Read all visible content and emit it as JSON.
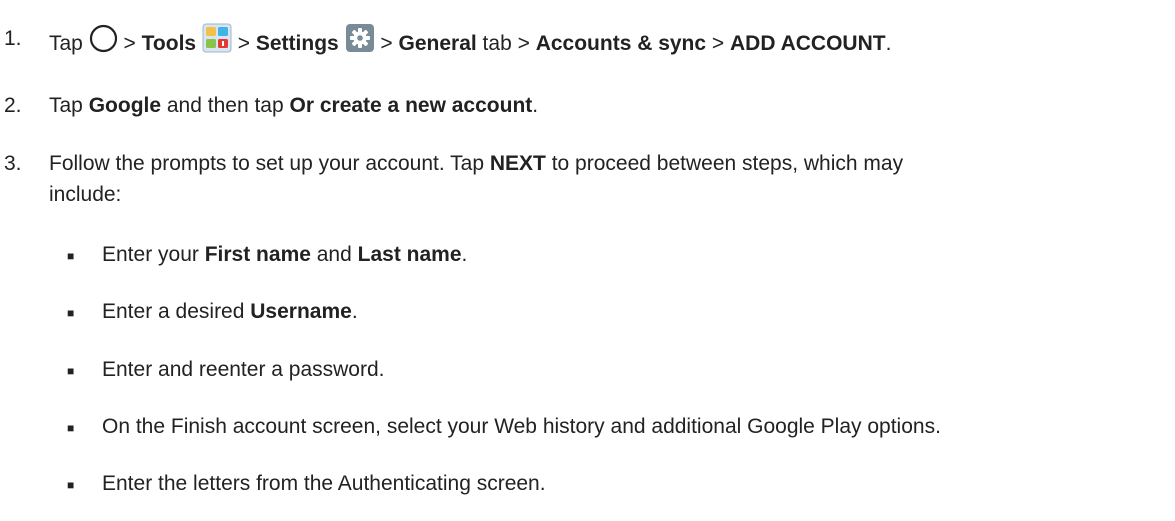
{
  "steps": [
    {
      "num": "1.",
      "s0": "Tap ",
      "s1": " > ",
      "tools": "Tools",
      "s2": " > ",
      "settings": "Settings",
      "s3": " > ",
      "general": "General",
      "s4": " tab > ",
      "accounts": "Accounts & sync",
      "s5": " > ",
      "add": "ADD ACCOUNT",
      "s6": "."
    },
    {
      "num": "2.",
      "s0": "Tap ",
      "google": "Google",
      "s1": " and then tap ",
      "create": "Or create a new account",
      "s2": "."
    },
    {
      "num": "3.",
      "s0": "Follow the prompts to set up your account. Tap ",
      "next": "NEXT",
      "s1": " to proceed between steps, which may",
      "line2": "include:"
    }
  ],
  "bullets": [
    {
      "a": "Enter your ",
      "b": "First name",
      "c": " and ",
      "d": "Last name",
      "e": "."
    },
    {
      "a": "Enter a desired ",
      "b": "Username",
      "c": "."
    },
    {
      "a": "Enter and reenter a password."
    },
    {
      "a": "On the Finish account screen, select your Web history and additional Google Play options."
    },
    {
      "a": "Enter the letters from the Authenticating screen."
    }
  ],
  "bullet_glyph": "■",
  "icons": [
    "home-circle-icon",
    "tools-folder-icon",
    "settings-gear-icon"
  ]
}
